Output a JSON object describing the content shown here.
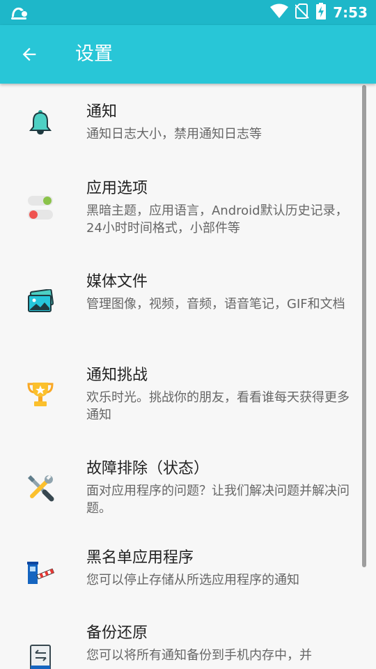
{
  "status_bar": {
    "time": "7:53",
    "app_icon": "notification-app-icon",
    "icons": [
      "wifi-icon",
      "no-sim-icon",
      "battery-charging-icon"
    ]
  },
  "app_bar": {
    "title": "设置",
    "back_icon": "arrow-left-icon"
  },
  "settings": [
    {
      "icon": "bell-icon",
      "title": "通知",
      "subtitle": "通知日志大小，禁用通知日志等"
    },
    {
      "icon": "toggle-switch-icon",
      "title": "应用选项",
      "subtitle": "黑暗主题，应用语言，Android默认历史记录，24小时时间格式，小部件等"
    },
    {
      "icon": "picture-icon",
      "title": "媒体文件",
      "subtitle": "管理图像，视频，音频，语音笔记，GIF和文档"
    },
    {
      "icon": "trophy-icon",
      "title": "通知挑战",
      "subtitle": "欢乐时光。挑战你的朋友，看看谁每天获得更多通知"
    },
    {
      "icon": "tools-icon",
      "title": "故障排除（状态）",
      "subtitle": "面对应用程序的问题？让我们解决问题并解决问题。"
    },
    {
      "icon": "barrier-icon",
      "title": "黑名单应用程序",
      "subtitle": "您可以停止存储从所选应用程序的通知"
    },
    {
      "icon": "backup-icon",
      "title": "备份还原",
      "subtitle": "您可以将所有通知备份到手机内存中，并"
    }
  ],
  "colors": {
    "status_bar": "#1eb7c9",
    "app_bar": "#28c6d7",
    "background": "#f7f7f7"
  }
}
